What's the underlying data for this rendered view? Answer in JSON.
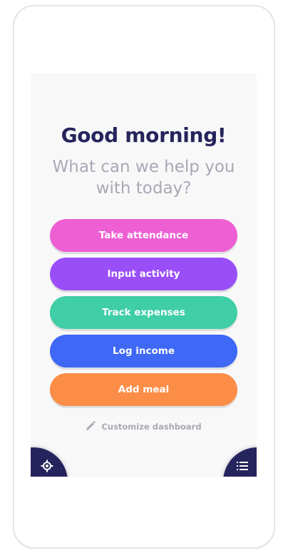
{
  "screen": {
    "greeting": "Good morning!",
    "subtitle": "What can we help you with today?",
    "actions": [
      {
        "label": "Take attendance",
        "color": "#ee5fd3"
      },
      {
        "label": "Input activity",
        "color": "#9a4ef8"
      },
      {
        "label": "Track expenses",
        "color": "#3fcea6"
      },
      {
        "label": "Log income",
        "color": "#3e68f5"
      },
      {
        "label": "Add meal",
        "color": "#fb8d47"
      }
    ],
    "customize": {
      "label": "Customize dashboard",
      "icon": "pencil-icon"
    },
    "bottom_left": {
      "icon": "settings-icon"
    },
    "bottom_right": {
      "icon": "list-icon"
    }
  },
  "colors": {
    "navy": "#26245c",
    "subtle_text": "#a9a8b6",
    "background": "#f8f8f9"
  }
}
